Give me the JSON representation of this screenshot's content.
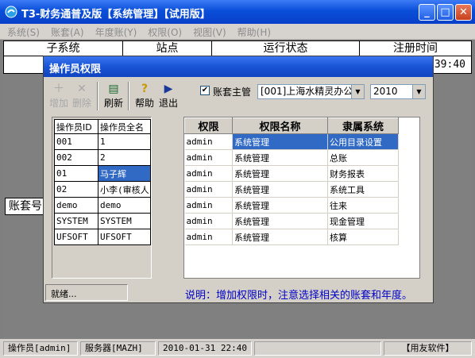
{
  "window": {
    "title": "T3-财务通普及版【系统管理】【试用版】",
    "min_label": "_",
    "max_label": "□",
    "close_label": "✕"
  },
  "menu": [
    "系统(S)",
    "账套(A)",
    "年度账(Y)",
    "权限(O)",
    "视图(V)",
    "帮助(H)"
  ],
  "main_grid": {
    "headers": [
      "子系统",
      "站点",
      "运行状态",
      "注册时间"
    ],
    "row_time": "39:40",
    "side_label": "账套号"
  },
  "dialog": {
    "title": "操作员权限",
    "toolbar": [
      {
        "label": "增加",
        "icon": "add-icon",
        "glyph": "＋",
        "enabled": false
      },
      {
        "label": "删除",
        "icon": "delete-icon",
        "glyph": "✕",
        "enabled": false
      },
      {
        "label": "刷新",
        "icon": "refresh-icon",
        "glyph": "▤",
        "enabled": true
      },
      {
        "label": "帮助",
        "icon": "help-icon",
        "glyph": "?",
        "enabled": true
      },
      {
        "label": "退出",
        "icon": "exit-icon",
        "glyph": "▶",
        "enabled": true
      }
    ],
    "master_checkbox": {
      "label": "账套主管",
      "checked": true,
      "mark": "✔"
    },
    "account_select": "[001]上海水精灵办公",
    "year_select": "2010",
    "operators": {
      "headers": [
        "操作员ID",
        "操作员全名"
      ],
      "rows": [
        {
          "id": "001",
          "name": "1"
        },
        {
          "id": "002",
          "name": "2"
        },
        {
          "id": "01",
          "name": "马子辉"
        },
        {
          "id": "02",
          "name": "小李(审核人"
        },
        {
          "id": "demo",
          "name": "demo"
        },
        {
          "id": "SYSTEM",
          "name": "SYSTEM"
        },
        {
          "id": "UFSOFT",
          "name": "UFSOFT"
        }
      ],
      "selected_index": 2
    },
    "permissions": {
      "headers": [
        "权限",
        "权限名称",
        "隶属系统"
      ],
      "rows": [
        {
          "perm": "admin",
          "name": "系统管理",
          "system": "公用目录设置"
        },
        {
          "perm": "admin",
          "name": "系统管理",
          "system": "总账"
        },
        {
          "perm": "admin",
          "name": "系统管理",
          "system": "财务报表"
        },
        {
          "perm": "admin",
          "name": "系统管理",
          "system": "系统工具"
        },
        {
          "perm": "admin",
          "name": "系统管理",
          "system": "往来"
        },
        {
          "perm": "admin",
          "name": "系统管理",
          "system": "现金管理"
        },
        {
          "perm": "admin",
          "name": "系统管理",
          "system": "核算"
        }
      ],
      "selected_index": 0
    },
    "status_ready": "就绪...",
    "note": "说明：增加权限时，注意选择相关的账套和年度。"
  },
  "statusbar": {
    "operator": "操作员[admin]",
    "server": "服务器[MAZH]",
    "datetime": "2010-01-31 22:40",
    "brand": "【用友软件】"
  },
  "colors": {
    "title_blue": "#0a4fd9",
    "selection": "#316ac5",
    "note_text": "#0000c8"
  }
}
